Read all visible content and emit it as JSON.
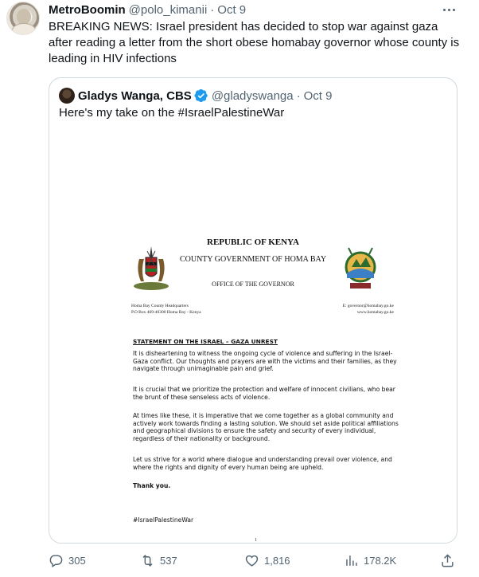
{
  "tweet": {
    "name": "MetroBoomin",
    "handle": "@polo_kimanii",
    "dot": "·",
    "date": "Oct 9",
    "text": "BREAKING NEWS: Israel president has decided to stop war against gaza after reading a letter from the short obese homabay governor whose county is leading in HIV infections"
  },
  "quote": {
    "name": "Gladys Wanga, CBS",
    "handle": "@gladyswanga",
    "dot": "·",
    "date": "Oct 9",
    "text": "Here's my take on the #IsraelPalestineWar",
    "document": {
      "title": "REPUBLIC OF KENYA",
      "county": "COUNTY GOVERNMENT OF HOMA BAY",
      "office": "OFFICE OF THE GOVERNOR",
      "address_left_1": "Homa Bay County Headquarters",
      "address_left_2": "P.O Box 469-40300 Homa Bay - Kenya",
      "address_right_1": "E: governor@homabay.go.ke",
      "address_right_2": "www.homabay.go.ke",
      "statement_heading": "STATEMENT ON THE ISRAEL – GAZA UNREST",
      "p1": "It is disheartening to witness the ongoing cycle of violence and suffering in the Israel-Gaza conflict. Our thoughts and prayers are with the victims and their families, as they navigate through unimaginable pain and grief.",
      "p2": "It is crucial that we prioritize the protection and welfare of innocent civilians, who bear the brunt of these senseless acts of violence.",
      "p3": "At times like these, it is imperative that we come together as a global community and actively work towards finding a lasting solution. We should set aside political affiliations and geographical divisions to ensure the safety and security of every individual, regardless of their nationality or background.",
      "p4": "Let us strive for a world where dialogue and understanding prevail over violence, and where the rights and dignity of every human being are upheld.",
      "p5": "#IsraelPalestineWar",
      "thanks": "Thank you.",
      "page_number": "1"
    }
  },
  "actions": {
    "replies": "305",
    "reposts": "537",
    "likes": "1,816",
    "views": "178.2K"
  },
  "icons": {
    "reply": "reply-icon",
    "repost": "repost-icon",
    "like": "heart-icon",
    "views": "views-icon",
    "share": "share-icon",
    "more": "more-icon",
    "verified": "verified-badge-icon"
  },
  "colors": {
    "verified": "#1d9bf0",
    "secondary_text": "#536471",
    "border": "#cfd9de"
  }
}
